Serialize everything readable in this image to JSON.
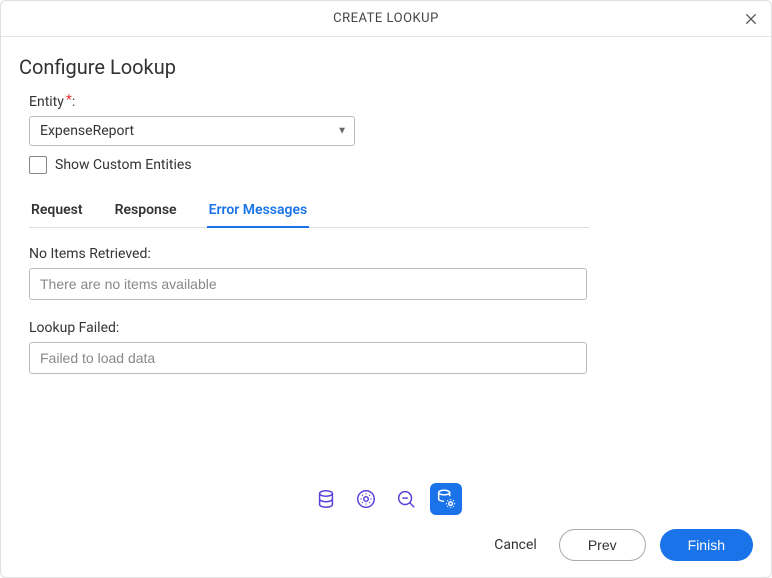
{
  "header": {
    "title": "CREATE LOOKUP"
  },
  "page": {
    "title": "Configure Lookup"
  },
  "entity": {
    "label": "Entity",
    "required_marker": "*",
    "label_colon": ":",
    "selected": "ExpenseReport"
  },
  "showCustom": {
    "label": "Show Custom Entities",
    "checked": false
  },
  "tabs": {
    "request": "Request",
    "response": "Response",
    "error": "Error Messages"
  },
  "fields": {
    "noItems": {
      "label": "No Items Retrieved:",
      "value": "There are no items available"
    },
    "lookupFailed": {
      "label": "Lookup Failed:",
      "value": "Failed to load data"
    }
  },
  "buttons": {
    "cancel": "Cancel",
    "prev": "Prev",
    "finish": "Finish"
  }
}
